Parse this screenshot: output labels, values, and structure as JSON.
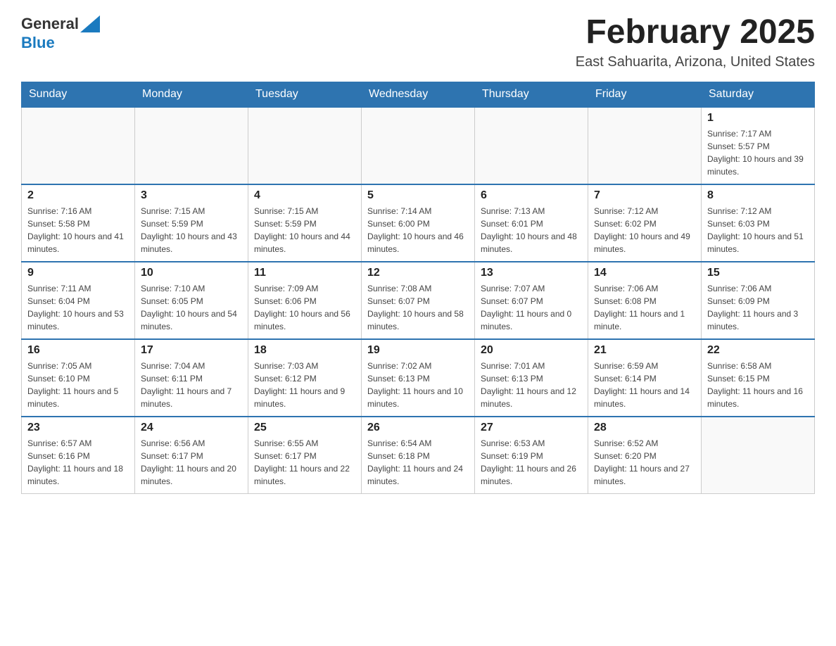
{
  "header": {
    "logo_general": "General",
    "logo_blue": "Blue",
    "month_title": "February 2025",
    "location": "East Sahuarita, Arizona, United States"
  },
  "weekdays": [
    "Sunday",
    "Monday",
    "Tuesday",
    "Wednesday",
    "Thursday",
    "Friday",
    "Saturday"
  ],
  "weeks": [
    [
      {
        "day": "",
        "info": ""
      },
      {
        "day": "",
        "info": ""
      },
      {
        "day": "",
        "info": ""
      },
      {
        "day": "",
        "info": ""
      },
      {
        "day": "",
        "info": ""
      },
      {
        "day": "",
        "info": ""
      },
      {
        "day": "1",
        "info": "Sunrise: 7:17 AM\nSunset: 5:57 PM\nDaylight: 10 hours and 39 minutes."
      }
    ],
    [
      {
        "day": "2",
        "info": "Sunrise: 7:16 AM\nSunset: 5:58 PM\nDaylight: 10 hours and 41 minutes."
      },
      {
        "day": "3",
        "info": "Sunrise: 7:15 AM\nSunset: 5:59 PM\nDaylight: 10 hours and 43 minutes."
      },
      {
        "day": "4",
        "info": "Sunrise: 7:15 AM\nSunset: 5:59 PM\nDaylight: 10 hours and 44 minutes."
      },
      {
        "day": "5",
        "info": "Sunrise: 7:14 AM\nSunset: 6:00 PM\nDaylight: 10 hours and 46 minutes."
      },
      {
        "day": "6",
        "info": "Sunrise: 7:13 AM\nSunset: 6:01 PM\nDaylight: 10 hours and 48 minutes."
      },
      {
        "day": "7",
        "info": "Sunrise: 7:12 AM\nSunset: 6:02 PM\nDaylight: 10 hours and 49 minutes."
      },
      {
        "day": "8",
        "info": "Sunrise: 7:12 AM\nSunset: 6:03 PM\nDaylight: 10 hours and 51 minutes."
      }
    ],
    [
      {
        "day": "9",
        "info": "Sunrise: 7:11 AM\nSunset: 6:04 PM\nDaylight: 10 hours and 53 minutes."
      },
      {
        "day": "10",
        "info": "Sunrise: 7:10 AM\nSunset: 6:05 PM\nDaylight: 10 hours and 54 minutes."
      },
      {
        "day": "11",
        "info": "Sunrise: 7:09 AM\nSunset: 6:06 PM\nDaylight: 10 hours and 56 minutes."
      },
      {
        "day": "12",
        "info": "Sunrise: 7:08 AM\nSunset: 6:07 PM\nDaylight: 10 hours and 58 minutes."
      },
      {
        "day": "13",
        "info": "Sunrise: 7:07 AM\nSunset: 6:07 PM\nDaylight: 11 hours and 0 minutes."
      },
      {
        "day": "14",
        "info": "Sunrise: 7:06 AM\nSunset: 6:08 PM\nDaylight: 11 hours and 1 minute."
      },
      {
        "day": "15",
        "info": "Sunrise: 7:06 AM\nSunset: 6:09 PM\nDaylight: 11 hours and 3 minutes."
      }
    ],
    [
      {
        "day": "16",
        "info": "Sunrise: 7:05 AM\nSunset: 6:10 PM\nDaylight: 11 hours and 5 minutes."
      },
      {
        "day": "17",
        "info": "Sunrise: 7:04 AM\nSunset: 6:11 PM\nDaylight: 11 hours and 7 minutes."
      },
      {
        "day": "18",
        "info": "Sunrise: 7:03 AM\nSunset: 6:12 PM\nDaylight: 11 hours and 9 minutes."
      },
      {
        "day": "19",
        "info": "Sunrise: 7:02 AM\nSunset: 6:13 PM\nDaylight: 11 hours and 10 minutes."
      },
      {
        "day": "20",
        "info": "Sunrise: 7:01 AM\nSunset: 6:13 PM\nDaylight: 11 hours and 12 minutes."
      },
      {
        "day": "21",
        "info": "Sunrise: 6:59 AM\nSunset: 6:14 PM\nDaylight: 11 hours and 14 minutes."
      },
      {
        "day": "22",
        "info": "Sunrise: 6:58 AM\nSunset: 6:15 PM\nDaylight: 11 hours and 16 minutes."
      }
    ],
    [
      {
        "day": "23",
        "info": "Sunrise: 6:57 AM\nSunset: 6:16 PM\nDaylight: 11 hours and 18 minutes."
      },
      {
        "day": "24",
        "info": "Sunrise: 6:56 AM\nSunset: 6:17 PM\nDaylight: 11 hours and 20 minutes."
      },
      {
        "day": "25",
        "info": "Sunrise: 6:55 AM\nSunset: 6:17 PM\nDaylight: 11 hours and 22 minutes."
      },
      {
        "day": "26",
        "info": "Sunrise: 6:54 AM\nSunset: 6:18 PM\nDaylight: 11 hours and 24 minutes."
      },
      {
        "day": "27",
        "info": "Sunrise: 6:53 AM\nSunset: 6:19 PM\nDaylight: 11 hours and 26 minutes."
      },
      {
        "day": "28",
        "info": "Sunrise: 6:52 AM\nSunset: 6:20 PM\nDaylight: 11 hours and 27 minutes."
      },
      {
        "day": "",
        "info": ""
      }
    ]
  ]
}
